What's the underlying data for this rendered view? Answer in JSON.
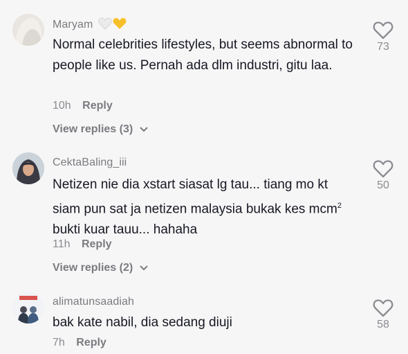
{
  "comments": [
    {
      "username": "Maryam",
      "text": "Normal celebrities lifestyles, but seems abnormal to people like us. Pernah ada dlm industri, gitu laa.",
      "time": "10h",
      "reply_label": "Reply",
      "view_replies": "View replies (3)",
      "likes": "73"
    },
    {
      "username": "CektaBaling_iii",
      "text_a": "Netizen nie dia xstart siasat lg tau... tiang mo kt siam pun sat ja netizen malaysia bukak kes mcm",
      "text_sup": "2",
      "text_b": " bukti kuar tauu... hahaha",
      "time": "11h",
      "reply_label": "Reply",
      "view_replies": "View replies (2)",
      "likes": "50"
    },
    {
      "username": "alimatunsaadiah",
      "text": "bak kate nabil, dia sedang diuji",
      "time": "7h",
      "reply_label": "Reply",
      "likes": "58"
    }
  ],
  "colors": {
    "background": "#f7f6f6",
    "text": "#161823",
    "secondary": "#8a8b91",
    "white_heart": "#e6e6e6",
    "yellow_heart": "#f7c02a"
  },
  "icons": [
    "heart-outline-icon",
    "chevron-down-icon",
    "white-heart-emoji",
    "yellow-heart-emoji"
  ]
}
